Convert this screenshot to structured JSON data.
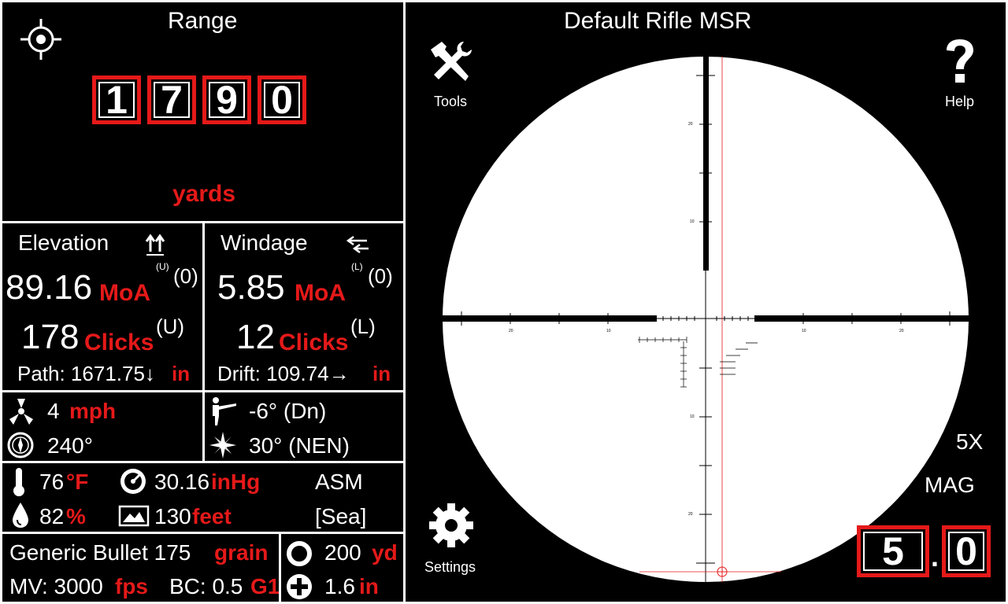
{
  "range": {
    "title": "Range",
    "digits": [
      "1",
      "7",
      "9",
      "0"
    ],
    "unit": "yards"
  },
  "elevation": {
    "title": "Elevation",
    "moa_value": "89.16",
    "moa_unit": "MoA",
    "moa_dir_small": "(U)",
    "moa_count": "(0)",
    "clicks_value": "178",
    "clicks_unit": "Clicks",
    "clicks_dir": "(U)",
    "path_label": "Path: 1671.75↓",
    "path_unit": "in"
  },
  "windage": {
    "title": "Windage",
    "moa_value": "5.85",
    "moa_unit": "MoA",
    "moa_dir_small": "(L)",
    "moa_count": "(0)",
    "clicks_value": "12",
    "clicks_unit": "Clicks",
    "clicks_dir": "(L)",
    "drift_label": "Drift: 109.74→",
    "drift_unit": "in"
  },
  "wind": {
    "speed": "4",
    "speed_unit": "mph",
    "direction": "240°"
  },
  "shooting": {
    "angle": "-6° (Dn)",
    "heading": "30° (NEN)"
  },
  "atmosphere": {
    "temp": "76",
    "temp_unit": "°F",
    "pressure": "30.16",
    "pressure_unit": "inHg",
    "pressure_ref": "ASM",
    "humidity": "82",
    "humidity_unit": "%",
    "altitude": "130",
    "altitude_unit": "feet",
    "altitude_ref": "[Sea]"
  },
  "bullet": {
    "name": "Generic Bullet 175",
    "weight_unit": "grain",
    "mv_label": "MV: 3000",
    "mv_unit": "fps",
    "bc_label": "BC: 0.5",
    "bc_model": "G1",
    "zero": "200",
    "zero_unit": "yd",
    "sight_height": "1.6",
    "sight_unit": "in"
  },
  "scope": {
    "title": "Default Rifle  MSR",
    "tools_label": "Tools",
    "help_label": "Help",
    "settings_label": "Settings",
    "mag_value": "5X",
    "mag_label": "MAG",
    "zoom_digits": [
      "5",
      "0"
    ],
    "zoom_sep": ".",
    "reticle_ticks": [
      "20",
      "10",
      "10",
      "20"
    ],
    "reticle_side_ticks": [
      "20",
      "10",
      "10",
      "20"
    ]
  },
  "colors": {
    "accent": "#e51919",
    "background": "#000000",
    "foreground": "#ffffff"
  }
}
